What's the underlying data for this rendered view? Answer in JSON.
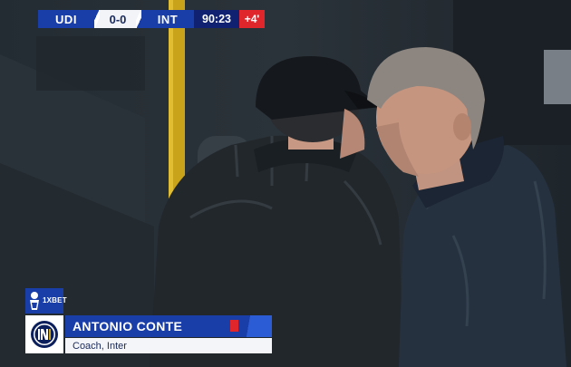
{
  "scoreboard": {
    "home_team": "UDI",
    "score": "0-0",
    "away_team": "INT",
    "clock": "90:23",
    "added_time": "+4'"
  },
  "lower_third": {
    "name": "ANTONIO CONTE",
    "role": "Coach, Inter",
    "sponsor": "1XBET"
  },
  "colors": {
    "bar_blue": "#1a3ea8",
    "clock_navy": "#0f2170",
    "accent_red": "#e0262b"
  },
  "icons": {
    "league": "serie-a-logo",
    "club": "inter-crest",
    "card": "red-card-icon"
  }
}
